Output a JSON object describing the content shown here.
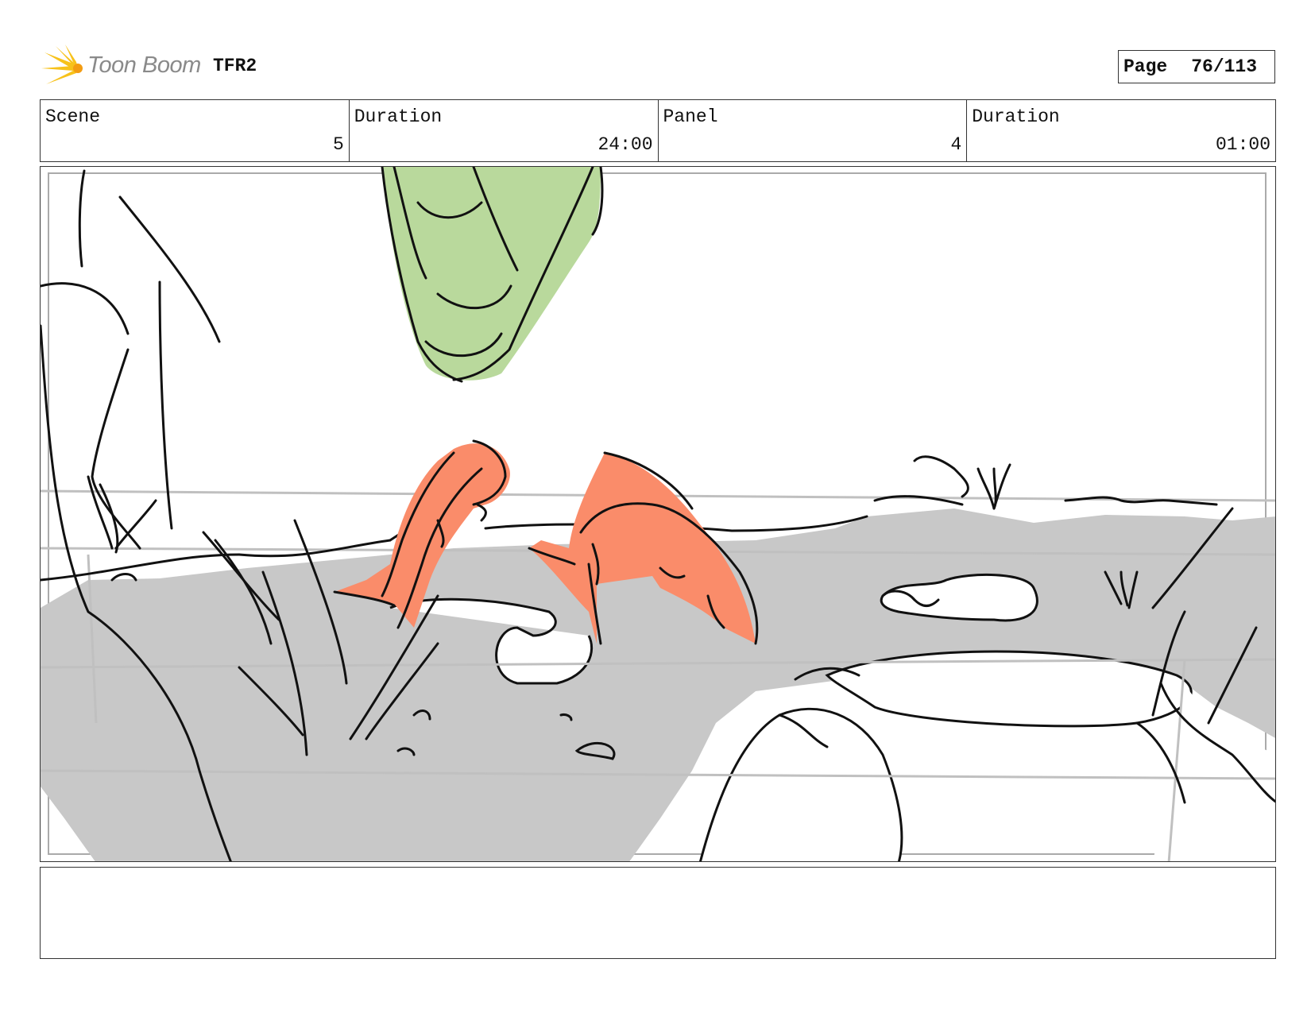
{
  "header": {
    "brand": "Toon Boom",
    "project": "TFR2",
    "page_label": "Page",
    "page_value": "76/113"
  },
  "info": {
    "scene_label": "Scene",
    "scene_value": "5",
    "scene_duration_label": "Duration",
    "scene_duration_value": "24:00",
    "panel_label": "Panel",
    "panel_value": "4",
    "panel_duration_label": "Duration",
    "panel_duration_value": "01:00"
  },
  "colors": {
    "fish": "#fa8c6a",
    "leaf": "#b9d99c",
    "ground": "#c8c8c8",
    "logo": "#f7c21b"
  },
  "notes": ""
}
